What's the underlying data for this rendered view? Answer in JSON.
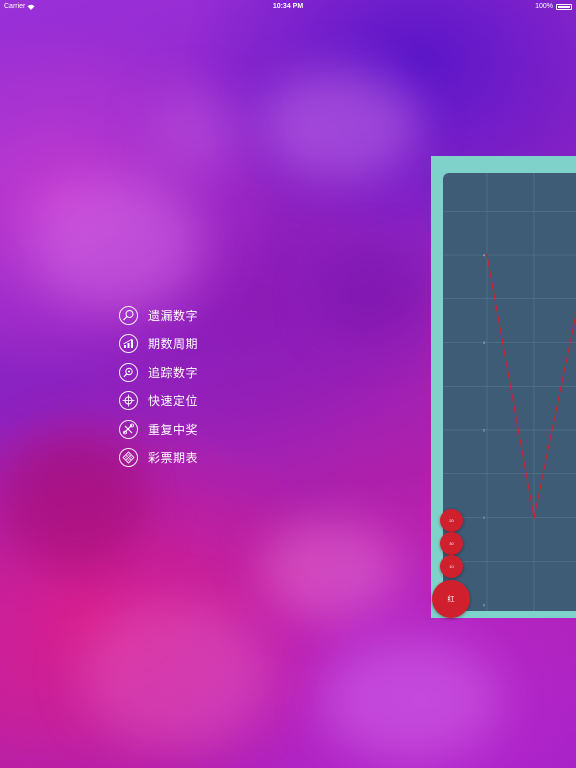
{
  "status_bar": {
    "carrier": "Carrier",
    "time": "10:34 PM",
    "battery": "100%"
  },
  "menu": {
    "items": [
      {
        "label": "遗漏数字",
        "icon": "magnifier-icon"
      },
      {
        "label": "期数周期",
        "icon": "bar-chart-icon"
      },
      {
        "label": "追踪数字",
        "icon": "search-icon"
      },
      {
        "label": "快速定位",
        "icon": "crosshair-icon"
      },
      {
        "label": "重复中奖",
        "icon": "tools-icon"
      },
      {
        "label": "彩票期表",
        "icon": "grid-icon"
      }
    ]
  },
  "fab_buttons": [
    {
      "label": "20"
    },
    {
      "label": "30"
    },
    {
      "label": "10"
    },
    {
      "label": "红"
    }
  ],
  "colors": {
    "panel_border": "#7fd2ca",
    "chart_bg": "#3e5c76",
    "line": "#d0202e",
    "fab": "#d0202e"
  },
  "chart_data": {
    "type": "line",
    "x_ticks": [
      "1",
      "2"
    ],
    "y_ticks": [
      "0",
      "1",
      "2",
      "3",
      "4",
      "5"
    ],
    "ylim": [
      0,
      5
    ],
    "series": [
      {
        "x": [
          1,
          2,
          3
        ],
        "values": [
          4,
          1,
          3.6
        ]
      }
    ],
    "grid": true
  }
}
